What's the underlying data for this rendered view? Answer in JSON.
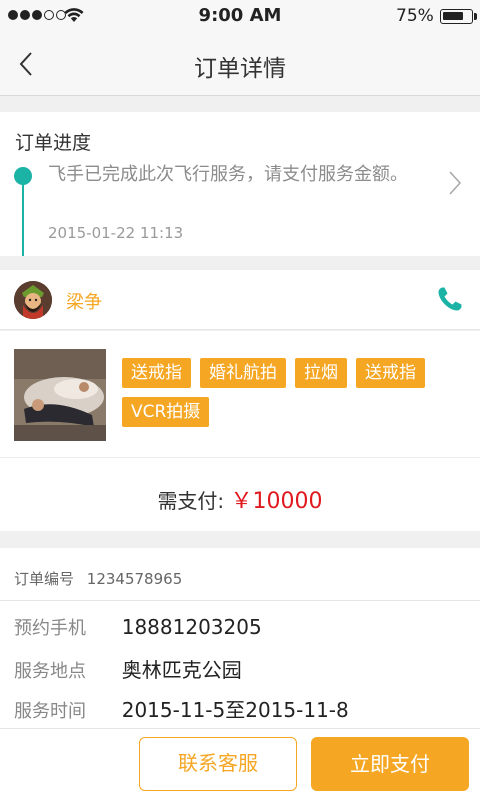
{
  "status_bar": {
    "time": "9:00 AM",
    "battery_text": "75%",
    "battery_level": 0.75
  },
  "nav": {
    "title": "订单详情",
    "back_icon": "chevron-left-icon"
  },
  "progress": {
    "title": "订单进度",
    "message": "飞手已完成此次飞行服务，请支付服务金额。",
    "time": "2015-01-22 11:13"
  },
  "pilot": {
    "name": "梁争",
    "phone_icon": "phone-icon"
  },
  "order": {
    "tags": [
      "送戒指",
      "婚礼航拍",
      "拉烟",
      "送戒指",
      "VCR拍摄"
    ],
    "pay_label": "需支付:",
    "pay_amount": "￥10000"
  },
  "info": {
    "order_no_label": "订单编号",
    "order_no_value": "1234578965",
    "rows": [
      {
        "label": "预约手机",
        "value": "18881203205"
      },
      {
        "label": "服务地点",
        "value": "奥林匹克公园"
      },
      {
        "label": "服务时间",
        "value": "2015-11-5至2015-11-8"
      }
    ]
  },
  "actions": {
    "contact_label": "联系客服",
    "pay_label": "立即支付"
  },
  "colors": {
    "accent": "#f5a623",
    "teal": "#1ab3a6",
    "price": "#e0191e"
  }
}
